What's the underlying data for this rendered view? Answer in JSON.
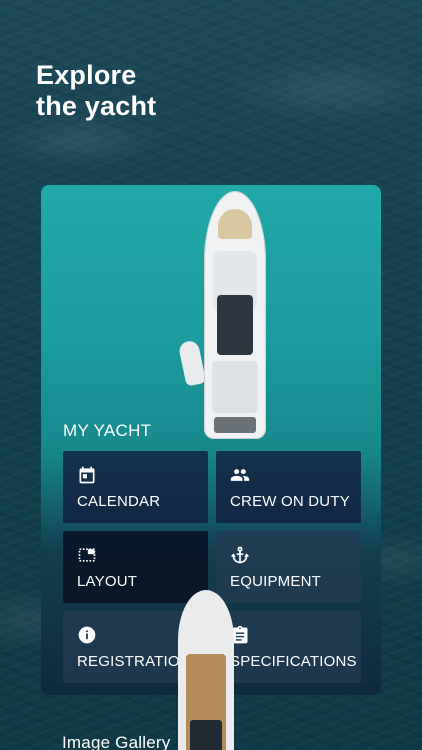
{
  "header": {
    "title_line1": "Explore",
    "title_line2": "the yacht"
  },
  "card": {
    "label": "MY YACHT"
  },
  "tiles": [
    {
      "label": "CALENDAR",
      "icon": "calendar-icon"
    },
    {
      "label": "CREW ON DUTY",
      "icon": "people-icon"
    },
    {
      "label": "LAYOUT",
      "icon": "layout-icon"
    },
    {
      "label": "EQUIPMENT",
      "icon": "anchor-icon"
    },
    {
      "label": "REGISTRATION",
      "icon": "info-icon"
    },
    {
      "label": "SPECIFICATIONS",
      "icon": "clipboard-icon"
    }
  ],
  "gallery": {
    "label": "Image Gallery"
  }
}
